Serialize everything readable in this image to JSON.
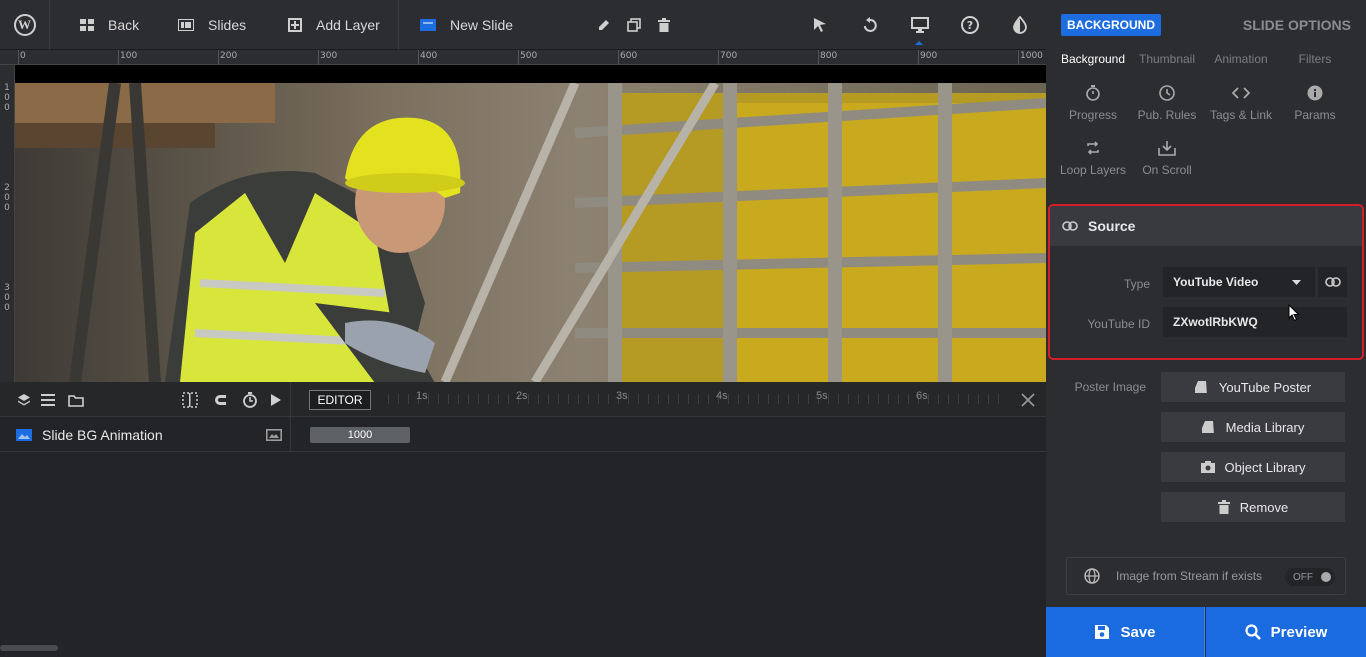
{
  "topbar": {
    "back_label": "Back",
    "slides_label": "Slides",
    "add_layer_label": "Add Layer",
    "new_slide_label": "New Slide"
  },
  "ruler": {
    "top_labels": [
      "0",
      "100",
      "200",
      "300",
      "400",
      "500",
      "600",
      "700",
      "800",
      "900",
      "1000"
    ],
    "left_labels": [
      "100",
      "200",
      "300"
    ]
  },
  "timeline": {
    "editor_label": "EDITOR",
    "seconds": [
      "1s",
      "2s",
      "3s",
      "4s",
      "5s",
      "6s"
    ],
    "row_label": "Slide BG Animation",
    "bar_value": "1000"
  },
  "panel": {
    "badge": "BACKGROUND",
    "slide_options": "SLIDE OPTIONS",
    "tabs": [
      "Background",
      "Thumbnail",
      "Animation",
      "Filters"
    ],
    "icon_items": [
      "Progress",
      "Pub. Rules",
      "Tags & Link",
      "Params",
      "Loop Layers",
      "On Scroll"
    ],
    "source_title": "Source",
    "type_label": "Type",
    "type_value": "YouTube Video",
    "youtube_id_label": "YouTube ID",
    "youtube_id_value": "ZXwotlRbKWQ",
    "poster_label": "Poster Image",
    "youtube_poster_btn": "YouTube Poster",
    "media_library_btn": "Media Library",
    "object_library_btn": "Object Library",
    "remove_btn": "Remove",
    "stream_label": "Image from Stream if exists",
    "stream_toggle": "OFF",
    "save_label": "Save",
    "preview_label": "Preview"
  },
  "colors": {
    "accent": "#1a6be0",
    "highlight": "#d21f26"
  }
}
